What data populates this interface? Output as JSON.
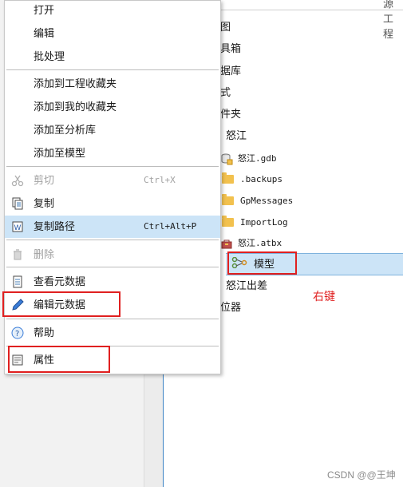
{
  "top_strip_text": "源 工程",
  "tree": {
    "partial_items": [
      "图",
      "具箱",
      "据库",
      "式",
      "件夹",
      "位器"
    ],
    "folder_root": "怒江",
    "items": [
      {
        "label": "怒江.gdb",
        "icon": "geodatabase-icon"
      },
      {
        "label": ".backups",
        "icon": "folder-icon"
      },
      {
        "label": "GpMessages",
        "icon": "folder-icon"
      },
      {
        "label": "ImportLog",
        "icon": "folder-icon"
      },
      {
        "label": "怒江.atbx",
        "icon": "toolbox-icon"
      },
      {
        "label": "模型",
        "icon": "model-icon",
        "selected": true
      },
      {
        "label": "怒江出差"
      }
    ]
  },
  "annotation": {
    "right_click": "右键"
  },
  "menu": {
    "items": [
      {
        "label": "打开"
      },
      {
        "label": "编辑"
      },
      {
        "label": "批处理"
      },
      {
        "label": "添加到工程收藏夹"
      },
      {
        "label": "添加到我的收藏夹"
      },
      {
        "label": "添加至分析库"
      },
      {
        "label": "添加至模型"
      },
      {
        "label": "剪切",
        "shortcut": "Ctrl+X",
        "disabled": true,
        "icon": "scissors-icon"
      },
      {
        "label": "复制",
        "icon": "copy-icon"
      },
      {
        "label": "复制路径",
        "shortcut": "Ctrl+Alt+P",
        "icon": "copy-path-icon",
        "hovered": true
      },
      {
        "label": "删除",
        "disabled": true,
        "icon": "trash-icon"
      },
      {
        "label": "查看元数据",
        "icon": "document-icon"
      },
      {
        "label": "编辑元数据",
        "icon": "pencil-icon"
      },
      {
        "label": "帮助",
        "icon": "help-icon"
      },
      {
        "label": "属性",
        "icon": "properties-icon"
      }
    ]
  },
  "colors": {
    "accent": "#cce4f7",
    "highlight": "#e02020"
  },
  "watermark": "CSDN @@王坤"
}
